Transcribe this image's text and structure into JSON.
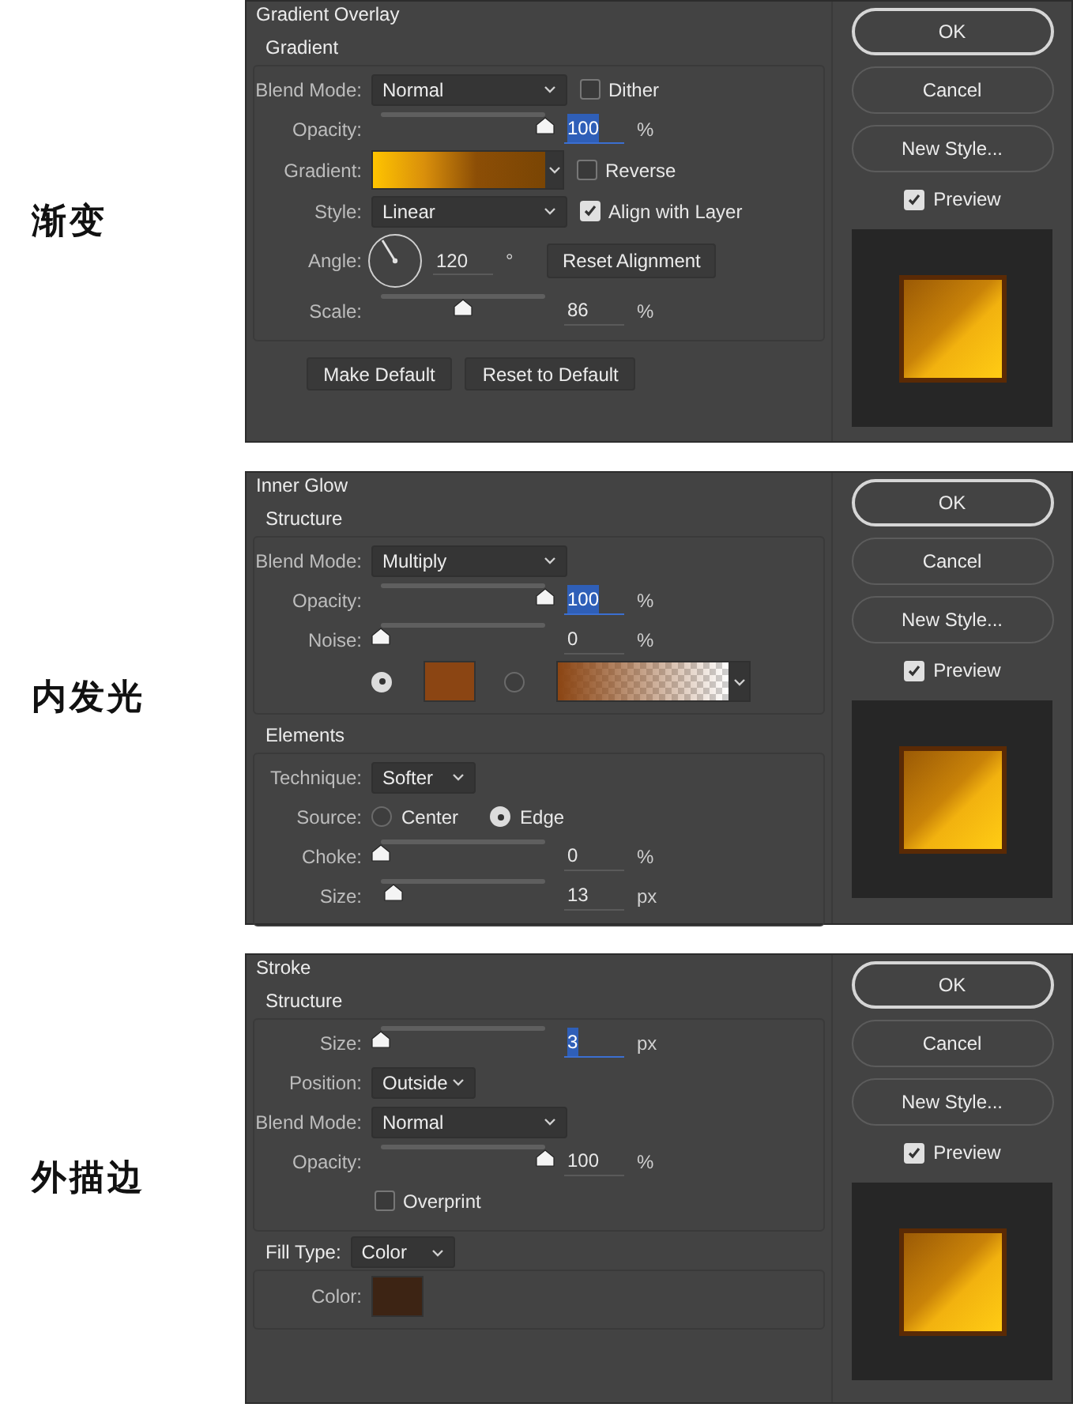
{
  "panels": [
    {
      "caption": "渐变",
      "title": "Gradient Overlay",
      "sections": [
        {
          "title": "Gradient",
          "rows": [
            {
              "label": "Blend Mode:",
              "controls": [
                {
                  "kind": "select",
                  "value": "Normal"
                },
                {
                  "kind": "checkbox",
                  "label": "Dither",
                  "checked": false
                }
              ]
            },
            {
              "label": "Opacity:",
              "controls": [
                {
                  "kind": "slider",
                  "level": 1
                },
                {
                  "kind": "number",
                  "value": "100",
                  "unit": "%",
                  "selected": true
                }
              ]
            },
            {
              "label": "Gradient:",
              "controls": [
                {
                  "kind": "gradient"
                },
                {
                  "kind": "checkbox",
                  "label": "Reverse",
                  "checked": false
                }
              ]
            },
            {
              "label": "Style:",
              "controls": [
                {
                  "kind": "select",
                  "value": "Linear"
                },
                {
                  "kind": "checkbox",
                  "label": "Align with Layer",
                  "checked": true
                }
              ]
            },
            {
              "label": "Angle:",
              "controls": [
                {
                  "kind": "angle"
                },
                {
                  "kind": "number",
                  "value": "120",
                  "unit": "°",
                  "selected": false
                },
                {
                  "kind": "button",
                  "label": "Reset Alignment"
                }
              ]
            },
            {
              "label": "Scale:",
              "controls": [
                {
                  "kind": "slider",
                  "level": 0.5
                },
                {
                  "kind": "number",
                  "value": "86",
                  "unit": "%",
                  "selected": false
                }
              ]
            }
          ]
        }
      ],
      "footer_buttons": [
        "Make Default",
        "Reset to Default"
      ],
      "buttons": [
        "OK",
        "Cancel",
        "New Style..."
      ],
      "preview": {
        "label": "Preview",
        "checked": true
      }
    },
    {
      "caption": "内发光",
      "title": "Inner Glow",
      "sections": [
        {
          "title": "Structure",
          "rows": [
            {
              "label": "Blend Mode:",
              "controls": [
                {
                  "kind": "select",
                  "value": "Multiply"
                }
              ]
            },
            {
              "label": "Opacity:",
              "controls": [
                {
                  "kind": "slider",
                  "level": 1
                },
                {
                  "kind": "number",
                  "value": "100",
                  "unit": "%",
                  "selected": true
                }
              ]
            },
            {
              "label": "Noise:",
              "controls": [
                {
                  "kind": "slider",
                  "level": 0
                },
                {
                  "kind": "number",
                  "value": "0",
                  "unit": "%",
                  "selected": false
                }
              ]
            },
            {
              "controls": [
                {
                  "kind": "radio",
                  "selected": true
                },
                {
                  "kind": "swatch",
                  "color": "#8b4513"
                },
                {
                  "kind": "radio",
                  "selected": false
                },
                {
                  "kind": "fade"
                }
              ]
            }
          ]
        },
        {
          "title": "Elements",
          "rows": [
            {
              "label": "Technique:",
              "controls": [
                {
                  "kind": "dropdown",
                  "value": "Softer"
                }
              ]
            },
            {
              "label": "Source:",
              "controls": [
                {
                  "kind": "radio",
                  "label": "Center",
                  "selected": false
                },
                {
                  "kind": "radio",
                  "label": "Edge",
                  "selected": true
                }
              ]
            },
            {
              "label": "Choke:",
              "controls": [
                {
                  "kind": "slider",
                  "level": 0
                },
                {
                  "kind": "number",
                  "value": "0",
                  "unit": "%",
                  "selected": false
                }
              ]
            },
            {
              "label": "Size:",
              "controls": [
                {
                  "kind": "slider",
                  "level": 0.08
                },
                {
                  "kind": "number",
                  "value": "13",
                  "unit": "px",
                  "selected": false
                }
              ]
            }
          ]
        }
      ],
      "buttons": [
        "OK",
        "Cancel",
        "New Style..."
      ],
      "preview": {
        "label": "Preview",
        "checked": true
      }
    },
    {
      "caption": "外描边",
      "title": "Stroke",
      "sections": [
        {
          "title": "Structure",
          "rows": [
            {
              "label": "Size:",
              "controls": [
                {
                  "kind": "slider",
                  "level": 0
                },
                {
                  "kind": "number",
                  "value": "3",
                  "unit": "px",
                  "selected": true
                }
              ]
            },
            {
              "label": "Position:",
              "controls": [
                {
                  "kind": "dropdown",
                  "value": "Outside"
                }
              ]
            },
            {
              "label": "Blend Mode:",
              "controls": [
                {
                  "kind": "select",
                  "value": "Normal"
                }
              ]
            },
            {
              "label": "Opacity:",
              "controls": [
                {
                  "kind": "slider",
                  "level": 1
                },
                {
                  "kind": "number",
                  "value": "100",
                  "unit": "%",
                  "selected": false
                }
              ]
            },
            {
              "controls": [
                {
                  "kind": "checkbox",
                  "label": "Overprint",
                  "checked": false
                }
              ]
            }
          ]
        },
        {
          "title": "Fill Type:",
          "header_control": {
            "kind": "dropdown",
            "value": "Color"
          },
          "rows": [
            {
              "label": "Color:",
              "controls": [
                {
                  "kind": "swatch",
                  "color": "#3d2414"
                }
              ]
            }
          ]
        }
      ],
      "buttons": [
        "OK",
        "Cancel",
        "New Style..."
      ],
      "preview": {
        "label": "Preview",
        "checked": true
      }
    }
  ]
}
